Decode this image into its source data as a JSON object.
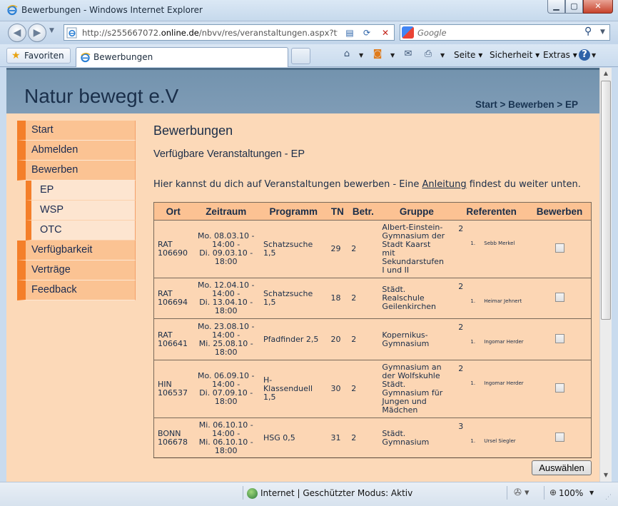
{
  "window": {
    "title": "Bewerbungen - Windows Internet Explorer",
    "minimize_glyph": "▁",
    "maximize_glyph": "▢",
    "close_glyph": "✕"
  },
  "navbar": {
    "url_prefix": "http://s255667072.",
    "url_domain": "online.de",
    "url_suffix": "/nbvv/res/veranstaltungen.aspx?type",
    "search_placeholder": "Google"
  },
  "tabbar": {
    "favorites_label": "Favoriten",
    "active_tab_label": "Bewerbungen",
    "page_menu": "Seite",
    "safety_menu": "Sicherheit",
    "extras_menu": "Extras"
  },
  "site": {
    "title": "Natur bewegt e.V",
    "breadcrumb": "Start > Bewerben > EP"
  },
  "sidebar": {
    "items": [
      {
        "label": "Start"
      },
      {
        "label": "Abmelden"
      },
      {
        "label": "Bewerben"
      },
      {
        "label": "EP"
      },
      {
        "label": "WSP"
      },
      {
        "label": "OTC"
      },
      {
        "label": "Verfügbarkeit"
      },
      {
        "label": "Verträge"
      },
      {
        "label": "Feedback"
      }
    ]
  },
  "content": {
    "heading": "Bewerbungen",
    "subheading": "Verfügbare Veranstaltungen - EP",
    "intro_before": "Hier kannst du dich auf Veranstaltungen bewerben - Eine ",
    "intro_link": "Anleitung",
    "intro_after": " findest du weiter unten."
  },
  "table": {
    "headers": [
      "Ort",
      "Zeitraum",
      "Programm",
      "TN",
      "Betr.",
      "Gruppe",
      "Referenten",
      "Bewerben"
    ],
    "rows": [
      {
        "ort": [
          "RAT",
          "106690"
        ],
        "zeitraum": [
          "Mo. 08.03.10 -",
          "14:00 -",
          "Di. 09.03.10 -",
          "18:00"
        ],
        "programm": [
          "Schatzsuche",
          "1,5"
        ],
        "tn": "29",
        "betr": "2",
        "gruppe": [
          "Albert-Einstein-",
          "Gymnasium der",
          "Stadt Kaarst",
          "mit",
          "Sekundarstufen",
          "I und II"
        ],
        "ref_count": "2",
        "referent": "Sebb Merkel"
      },
      {
        "ort": [
          "RAT",
          "106694"
        ],
        "zeitraum": [
          "Mo. 12.04.10 -",
          "14:00 -",
          "Di. 13.04.10 -",
          "18:00"
        ],
        "programm": [
          "Schatzsuche",
          "1,5"
        ],
        "tn": "18",
        "betr": "2",
        "gruppe": [
          "Städt.",
          "Realschule",
          "Geilenkirchen"
        ],
        "ref_count": "2",
        "referent": "Heimar Jehnert"
      },
      {
        "ort": [
          "RAT",
          "106641"
        ],
        "zeitraum": [
          "Mo. 23.08.10 -",
          "14:00 -",
          "Mi. 25.08.10 -",
          "18:00"
        ],
        "programm": [
          "Pfadfinder 2,5"
        ],
        "tn": "20",
        "betr": "2",
        "gruppe": [
          "Kopernikus-",
          "Gymnasium"
        ],
        "ref_count": "2",
        "referent": "Ingomar Herder"
      },
      {
        "ort": [
          "HIN",
          "106537"
        ],
        "zeitraum": [
          "Mo. 06.09.10 -",
          "14:00 -",
          "Di. 07.09.10 -",
          "18:00"
        ],
        "programm": [
          "H-",
          "Klassenduell",
          "1,5"
        ],
        "tn": "30",
        "betr": "2",
        "gruppe": [
          "Gymnasium an",
          "der Wolfskuhle",
          "Städt.",
          "Gymnasium für",
          "Jungen und",
          "Mädchen"
        ],
        "ref_count": "2",
        "referent": "Ingomar Herder"
      },
      {
        "ort": [
          "BONN",
          "106678"
        ],
        "zeitraum": [
          "Mi. 06.10.10 -",
          "14:00 -",
          "Mi. 06.10.10 -",
          "18:00"
        ],
        "programm": [
          "HSG 0,5"
        ],
        "tn": "31",
        "betr": "2",
        "gruppe": [
          "Städt.",
          "Gymnasium"
        ],
        "ref_count": "3",
        "referent": "Ursel Siegler"
      }
    ],
    "submit_label": "Auswählen"
  },
  "statusbar": {
    "zone": "Internet | Geschützter Modus: Aktiv",
    "zoom": "100%"
  },
  "colors": {
    "page_bg": "#fcd9b8",
    "sidebar_accent": "#f47f2a",
    "header_bg": "#7f9cb6"
  }
}
